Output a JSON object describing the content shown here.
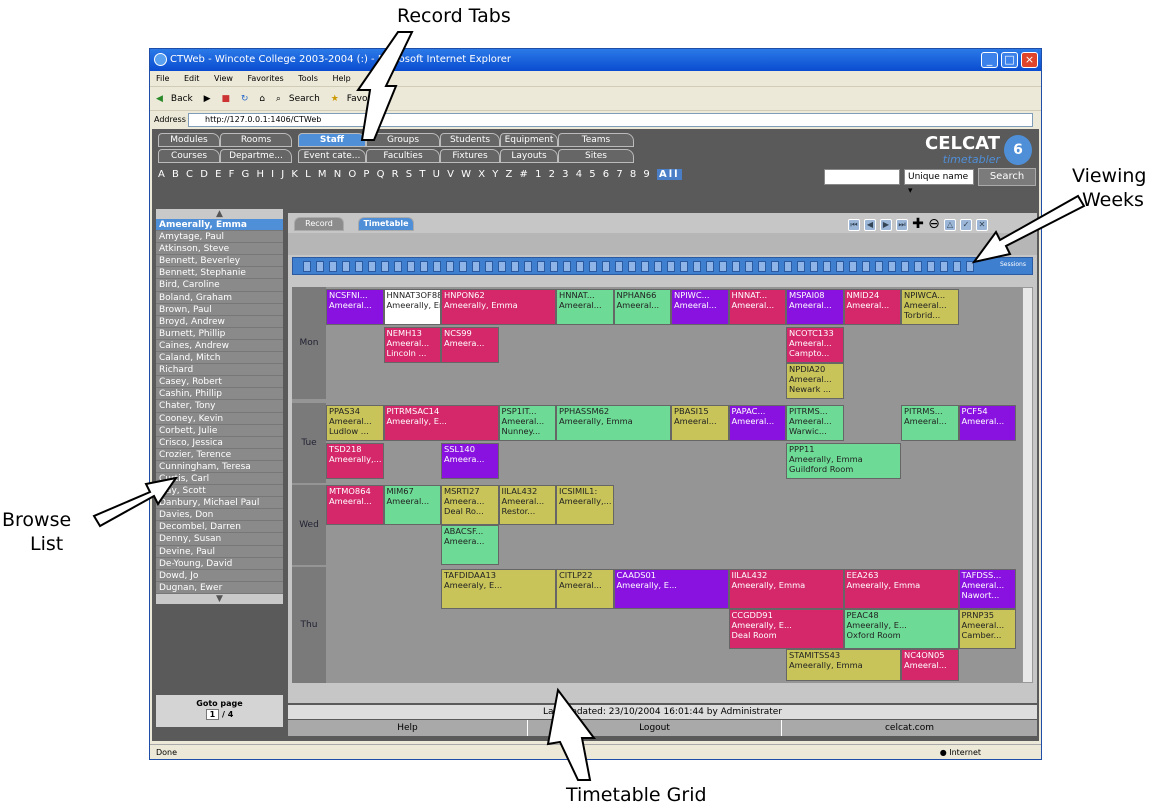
{
  "callouts": {
    "record_tabs": "Record Tabs",
    "viewing_weeks_1": "Viewing",
    "viewing_weeks_2": "Weeks",
    "browse_1": "Browse",
    "browse_2": "List",
    "timetable_grid": "Timetable Grid"
  },
  "window": {
    "title": "CTWeb - Wincote College 2003-2004 (:)  - Microsoft Internet Explorer"
  },
  "menu": [
    "File",
    "Edit",
    "View",
    "Favorites",
    "Tools",
    "Help"
  ],
  "toolbar": [
    "Back",
    "Search",
    "Favorites"
  ],
  "address": {
    "label": "Address",
    "url": "http://127.0.0.1:1406/CTWeb"
  },
  "tabs_row1": [
    "Modules",
    "Rooms",
    "Staff",
    "Groups",
    "Students",
    "Equipment",
    "Teams"
  ],
  "tabs_row2": [
    "Courses",
    "Departme...",
    "Event cate...",
    "Faculties",
    "Fixtures",
    "Layouts",
    "Sites"
  ],
  "letters": "A B C D E F G H I J K L M N O P Q R S T U V W X Y Z # 1 2 3 4 5 6 7 8 9",
  "letters_all": "All",
  "logo": {
    "name": "CELCAT",
    "sub": "timetabler",
    "ver": "6"
  },
  "search": {
    "select": "Unique name",
    "button": "Search"
  },
  "browse": [
    "Ameerally, Emma",
    "Amytage, Paul",
    "Atkinson, Steve",
    "Bennett, Beverley",
    "Bennett, Stephanie",
    "Bird, Caroline",
    "Boland, Graham",
    "Brown, Paul",
    "Broyd, Andrew",
    "Burnett, Phillip",
    "Caines, Andrew",
    "Caland, Mitch",
    "Richard",
    "Casey, Robert",
    "Cashin, Phillip",
    "Chater, Tony",
    "Cooney, Kevin",
    "Corbett, Julie",
    "Crisco, Jessica",
    "Crozier, Terence",
    "Cunningham, Teresa",
    "Curtis, Carl",
    "Day, Scott",
    "Danbury, Michael Paul",
    "Davies, Don",
    "Decombel, Darren",
    "Denny, Susan",
    "Devine, Paul",
    "De-Young, David",
    "Dowd, Jo",
    "Dugnan, Ewer"
  ],
  "goto": {
    "label": "Goto page",
    "page": "1",
    "total": "/ 4"
  },
  "subtabs": [
    "Record",
    "Timetable"
  ],
  "weeks_label": "Sessions",
  "days": [
    "Mon",
    "Tue",
    "Wed",
    "Thu"
  ],
  "events": [
    [
      "NCSFNI...",
      "Ameeral..."
    ],
    [
      "HNNAT3OF88",
      "Ameerally, Emma"
    ],
    [
      "HNPON62",
      "Ameerally, Emma"
    ],
    [
      "HNNAT...",
      "Ameeral..."
    ],
    [
      "NPHAN66",
      "Ameeral..."
    ],
    [
      "NPIWC...",
      "Ameeral..."
    ],
    [
      "HNNAT...",
      "Ameeral..."
    ],
    [
      "MSPAI08",
      "Ameeral..."
    ],
    [
      "NMID24",
      "Ameeral..."
    ],
    [
      "NPIWCA...",
      "Ameeral...",
      "Torbrid..."
    ],
    [
      "NEMH13",
      "Ameeral...",
      "Lincoln ..."
    ],
    [
      "NCS99",
      "Ameera..."
    ],
    [
      "NCOTC133",
      "Ameeral...",
      "Campto..."
    ],
    [
      "NPDIA20",
      "Ameeral...",
      "Newark ..."
    ],
    [
      "PPAS34",
      "Ameeral...",
      "Ludlow ..."
    ],
    [
      "PITRMSAC14",
      "Ameerally, E..."
    ],
    [
      "PSP1IT...",
      "Ameeral...",
      "Nunney..."
    ],
    [
      "PPHASSM62",
      "Ameerally, Emma"
    ],
    [
      "PBASI15",
      "Ameeral..."
    ],
    [
      "PAPAC...",
      "Ameeral..."
    ],
    [
      "PITRMS...",
      "Ameeral...",
      "Warwic..."
    ],
    [
      "PITRMS...",
      "Ameeral..."
    ],
    [
      "PCF54",
      "Ameeral..."
    ],
    [
      "TSD218",
      "Ameerally,..."
    ],
    [
      "SSL140",
      "Ameera..."
    ],
    [
      "PPP11",
      "Ameerally, Emma",
      "Guildford Room"
    ],
    [
      "MTMO864",
      "Ameeral..."
    ],
    [
      "MIM67",
      "Ameeral..."
    ],
    [
      "MSRTI27",
      "Ameera...",
      "Deal Ro..."
    ],
    [
      "IILAL432",
      "Ameeral...",
      "Restor..."
    ],
    [
      "ICSIMIL1:",
      "Ameerally,..."
    ],
    [
      "ABACSF...",
      "Ameera..."
    ],
    [
      "TAFDIDAA13",
      "Ameeraly, E..."
    ],
    [
      "CITLP22",
      "Ameeral..."
    ],
    [
      "CAADS01",
      "Ameerally, E..."
    ],
    [
      "IILAL432",
      "Ameerally, Emma"
    ],
    [
      "EEA263",
      "Ameerally, Emma"
    ],
    [
      "TAFDSS...",
      "Ameeral...",
      "Nawort..."
    ],
    [
      "CCGDD91",
      "Ameerally, E...",
      "Deal Room"
    ],
    [
      "PEAC48",
      "Ameerally, E...",
      "Oxford Room"
    ],
    [
      "PRNP35",
      "Ameeral...",
      "Camber..."
    ],
    [
      "STAMITSS43",
      "Ameerally, Emma"
    ],
    [
      "NC4ON05",
      "Ameeral..."
    ]
  ],
  "status": "Last Updated: 23/10/2004 16:01:44 by Administrater",
  "footer": [
    "Help",
    "Logout",
    "celcat.com"
  ],
  "iestatus": {
    "left": "Done",
    "right": "Internet"
  }
}
